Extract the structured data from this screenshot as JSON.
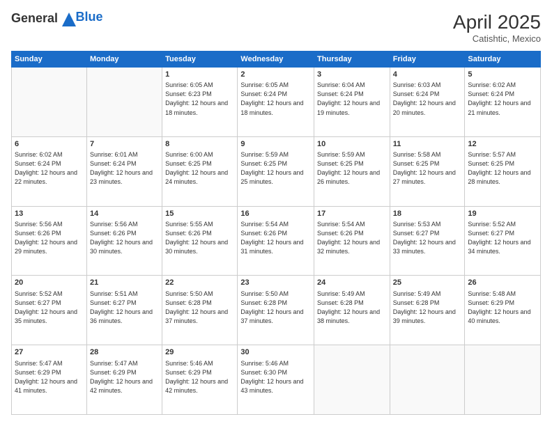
{
  "header": {
    "logo": {
      "general": "General",
      "blue": "Blue"
    },
    "title": "April 2025",
    "location": "Catishtic, Mexico"
  },
  "weekdays": [
    "Sunday",
    "Monday",
    "Tuesday",
    "Wednesday",
    "Thursday",
    "Friday",
    "Saturday"
  ],
  "weeks": [
    [
      {
        "day": "",
        "info": ""
      },
      {
        "day": "",
        "info": ""
      },
      {
        "day": "1",
        "info": "Sunrise: 6:05 AM\nSunset: 6:23 PM\nDaylight: 12 hours and 18 minutes."
      },
      {
        "day": "2",
        "info": "Sunrise: 6:05 AM\nSunset: 6:24 PM\nDaylight: 12 hours and 18 minutes."
      },
      {
        "day": "3",
        "info": "Sunrise: 6:04 AM\nSunset: 6:24 PM\nDaylight: 12 hours and 19 minutes."
      },
      {
        "day": "4",
        "info": "Sunrise: 6:03 AM\nSunset: 6:24 PM\nDaylight: 12 hours and 20 minutes."
      },
      {
        "day": "5",
        "info": "Sunrise: 6:02 AM\nSunset: 6:24 PM\nDaylight: 12 hours and 21 minutes."
      }
    ],
    [
      {
        "day": "6",
        "info": "Sunrise: 6:02 AM\nSunset: 6:24 PM\nDaylight: 12 hours and 22 minutes."
      },
      {
        "day": "7",
        "info": "Sunrise: 6:01 AM\nSunset: 6:24 PM\nDaylight: 12 hours and 23 minutes."
      },
      {
        "day": "8",
        "info": "Sunrise: 6:00 AM\nSunset: 6:25 PM\nDaylight: 12 hours and 24 minutes."
      },
      {
        "day": "9",
        "info": "Sunrise: 5:59 AM\nSunset: 6:25 PM\nDaylight: 12 hours and 25 minutes."
      },
      {
        "day": "10",
        "info": "Sunrise: 5:59 AM\nSunset: 6:25 PM\nDaylight: 12 hours and 26 minutes."
      },
      {
        "day": "11",
        "info": "Sunrise: 5:58 AM\nSunset: 6:25 PM\nDaylight: 12 hours and 27 minutes."
      },
      {
        "day": "12",
        "info": "Sunrise: 5:57 AM\nSunset: 6:25 PM\nDaylight: 12 hours and 28 minutes."
      }
    ],
    [
      {
        "day": "13",
        "info": "Sunrise: 5:56 AM\nSunset: 6:26 PM\nDaylight: 12 hours and 29 minutes."
      },
      {
        "day": "14",
        "info": "Sunrise: 5:56 AM\nSunset: 6:26 PM\nDaylight: 12 hours and 30 minutes."
      },
      {
        "day": "15",
        "info": "Sunrise: 5:55 AM\nSunset: 6:26 PM\nDaylight: 12 hours and 30 minutes."
      },
      {
        "day": "16",
        "info": "Sunrise: 5:54 AM\nSunset: 6:26 PM\nDaylight: 12 hours and 31 minutes."
      },
      {
        "day": "17",
        "info": "Sunrise: 5:54 AM\nSunset: 6:26 PM\nDaylight: 12 hours and 32 minutes."
      },
      {
        "day": "18",
        "info": "Sunrise: 5:53 AM\nSunset: 6:27 PM\nDaylight: 12 hours and 33 minutes."
      },
      {
        "day": "19",
        "info": "Sunrise: 5:52 AM\nSunset: 6:27 PM\nDaylight: 12 hours and 34 minutes."
      }
    ],
    [
      {
        "day": "20",
        "info": "Sunrise: 5:52 AM\nSunset: 6:27 PM\nDaylight: 12 hours and 35 minutes."
      },
      {
        "day": "21",
        "info": "Sunrise: 5:51 AM\nSunset: 6:27 PM\nDaylight: 12 hours and 36 minutes."
      },
      {
        "day": "22",
        "info": "Sunrise: 5:50 AM\nSunset: 6:28 PM\nDaylight: 12 hours and 37 minutes."
      },
      {
        "day": "23",
        "info": "Sunrise: 5:50 AM\nSunset: 6:28 PM\nDaylight: 12 hours and 37 minutes."
      },
      {
        "day": "24",
        "info": "Sunrise: 5:49 AM\nSunset: 6:28 PM\nDaylight: 12 hours and 38 minutes."
      },
      {
        "day": "25",
        "info": "Sunrise: 5:49 AM\nSunset: 6:28 PM\nDaylight: 12 hours and 39 minutes."
      },
      {
        "day": "26",
        "info": "Sunrise: 5:48 AM\nSunset: 6:29 PM\nDaylight: 12 hours and 40 minutes."
      }
    ],
    [
      {
        "day": "27",
        "info": "Sunrise: 5:47 AM\nSunset: 6:29 PM\nDaylight: 12 hours and 41 minutes."
      },
      {
        "day": "28",
        "info": "Sunrise: 5:47 AM\nSunset: 6:29 PM\nDaylight: 12 hours and 42 minutes."
      },
      {
        "day": "29",
        "info": "Sunrise: 5:46 AM\nSunset: 6:29 PM\nDaylight: 12 hours and 42 minutes."
      },
      {
        "day": "30",
        "info": "Sunrise: 5:46 AM\nSunset: 6:30 PM\nDaylight: 12 hours and 43 minutes."
      },
      {
        "day": "",
        "info": ""
      },
      {
        "day": "",
        "info": ""
      },
      {
        "day": "",
        "info": ""
      }
    ]
  ]
}
